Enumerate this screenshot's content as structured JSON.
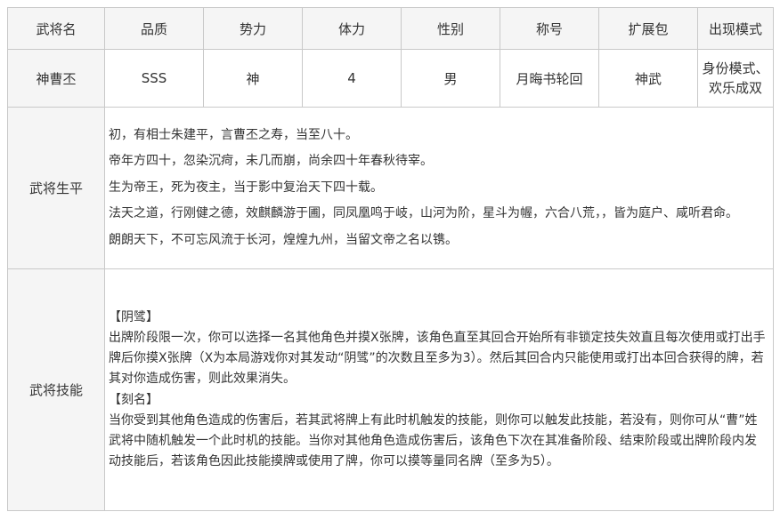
{
  "headers": [
    "武将名",
    "品质",
    "势力",
    "体力",
    "性别",
    "称号",
    "扩展包",
    "出现模式"
  ],
  "general": {
    "name": "神曹丕",
    "quality": "SSS",
    "faction": "神",
    "hp": "4",
    "gender": "男",
    "title": "月晦书轮回",
    "expansion": "神武",
    "modes": [
      "身份模式、",
      "欢乐成双"
    ]
  },
  "bio": {
    "label": "武将生平",
    "lines": [
      "初，有相士朱建平，言曹丕之寿，当至八十。",
      "帝年方四十，忽染沉疴，未几而崩，尚余四十年春秋待宰。",
      "生为帝王，死为夜主，当于影中复治天下四十载。",
      "法天之道，行刚健之德，效麒麟游于圃，同凤凰鸣于岐，山河为阶，星斗为幄，六合八荒，，皆为庭户、咸听君命。",
      "朗朗天下，不可忘风流于长河，煌煌九州，当留文帝之名以镌。"
    ]
  },
  "skills": {
    "label": "武将技能",
    "items": [
      {
        "name": "【阴骘】",
        "desc": "出牌阶段限一次，你可以选择一名其他角色并摸X张牌，该角色直至其回合开始所有非锁定技失效直且每次使用或打出手牌后你摸X张牌（X为本局游戏你对其发动“阴骘”的次数且至多为3）。然后其回合内只能使用或打出本回合获得的牌，若其对你造成伤害，则此效果消失。"
      },
      {
        "name": "【刻名】",
        "desc": "当你受到其他角色造成的伤害后，若其武将牌上有此时机触发的技能，则你可以触发此技能，若没有，则你可从“曹”姓武将中随机触发一个此时机的技能。当你对其他角色造成伤害后，该角色下次在其准备阶段、结束阶段或出牌阶段内发动技能后，若该角色因此技能摸牌或使用了牌，你可以摸等量同名牌（至多为5）。"
      }
    ]
  }
}
